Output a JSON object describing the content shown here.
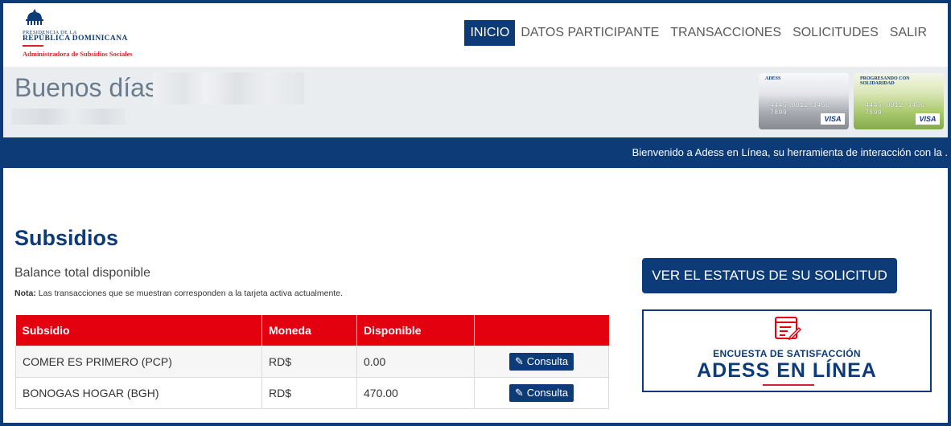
{
  "logo": {
    "line1": "PRESIDENCIA DE LA",
    "line2": "REPÚBLICA DOMINICANA",
    "line3": "Administradora de Subsidios Sociales"
  },
  "nav": {
    "items": [
      "INICIO",
      "DATOS PARTICIPANTE",
      "TRANSACCIONES",
      "SOLICITUDES",
      "SALIR"
    ],
    "active": "INICIO"
  },
  "greeting": {
    "text": "Buenos días,"
  },
  "cards": [
    {
      "number": "4445  0012  3456  7899",
      "brand": "ADESS",
      "network": "VISA"
    },
    {
      "number": "4445  0012  3456  7899",
      "brand": "PROGRESANDO CON SOLIDARIDAD",
      "network": "VISA"
    }
  ],
  "marquee": {
    "text": "Bienvenido a Adess en Línea, su herramienta de interacción con la ."
  },
  "main": {
    "title": "Subsidios",
    "balance_label": "Balance total disponible",
    "note_label": "Nota:",
    "note_text": " Las transacciones que se muestran corresponden a la tarjeta activa actualmente."
  },
  "table": {
    "headers": [
      "Subsidio",
      "Moneda",
      "Disponible",
      ""
    ],
    "rows": [
      {
        "subsidio": "COMER ES PRIMERO (PCP)",
        "moneda": "RD$",
        "disponible": "0.00",
        "action": "Consulta"
      },
      {
        "subsidio": "BONOGAS HOGAR (BGH)",
        "moneda": "RD$",
        "disponible": "470.00",
        "action": "Consulta"
      }
    ]
  },
  "status_button": {
    "label": "VER EL ESTATUS DE SU SOLICITUD"
  },
  "survey": {
    "line1": "ENCUESTA DE SATISFACCIÓN",
    "line2": "ADESS EN LÍNEA"
  },
  "colors": {
    "navy": "#0c3b78",
    "red": "#e3000f"
  }
}
